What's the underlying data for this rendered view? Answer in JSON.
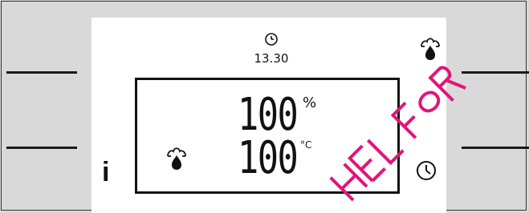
{
  "display": {
    "time": "13.30",
    "value_top": "100",
    "unit_top": "%",
    "value_bottom": "100",
    "unit_bottom": "°C",
    "info_label": "i"
  },
  "icons": {
    "clock_top": "clock-icon",
    "flame_top": "burner-flame-icon",
    "flame_box": "burner-flame-icon",
    "clock_corner": "clock-icon",
    "info": "info-icon"
  },
  "watermark": {
    "text": "HEL FOR",
    "color": "#e0157a"
  },
  "colors": {
    "background": "#d9d9d9",
    "screen": "#ffffff",
    "ink": "#111111"
  }
}
